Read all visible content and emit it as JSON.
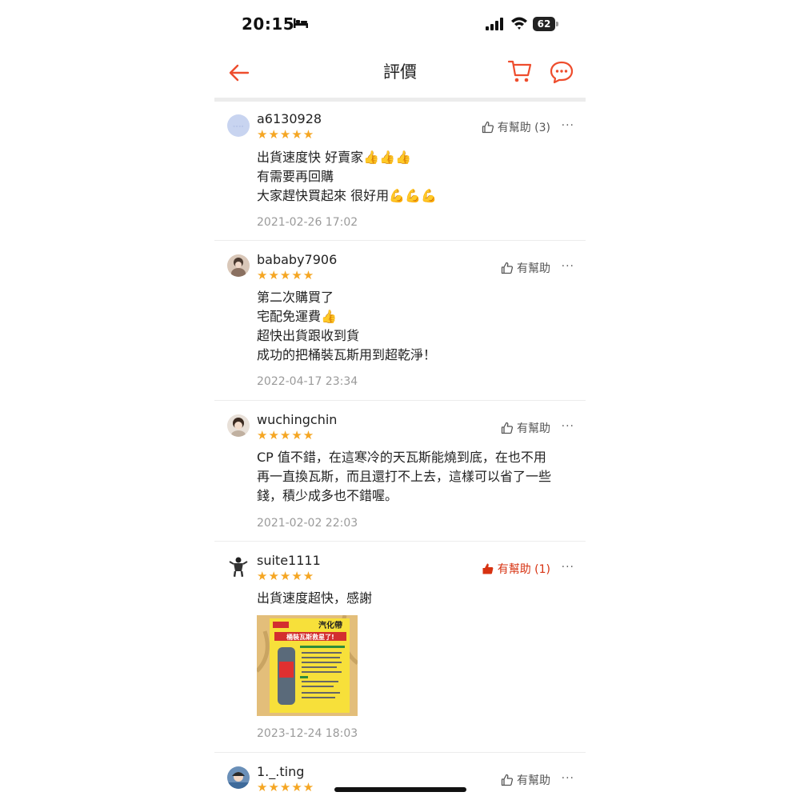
{
  "status_bar": {
    "time": "20:15",
    "battery": "62"
  },
  "header": {
    "title": "評價"
  },
  "icons": {
    "back": "arrow-left-icon",
    "cart": "shopping-cart-icon",
    "chat": "chat-bubble-icon",
    "thumb": "thumbs-up-icon",
    "more": "more-icon"
  },
  "colors": {
    "accent": "#ee4d2d",
    "stars": "#f5a623",
    "helpful_active": "#d73211"
  },
  "reviews": [
    {
      "username": "a6130928",
      "rating": 5,
      "stars": "★★★★★",
      "helpful": "有幫助 (3)",
      "helpful_active": false,
      "more": "···",
      "comment_lines": [
        "出貨速度快 好賣家",
        "有需要再回購",
        "大家趕快買起來 很好用"
      ],
      "emojis": [
        "👍👍👍",
        "",
        "💪💪💪"
      ],
      "date": "2021-02-26 17:02"
    },
    {
      "username": "bababy7906",
      "rating": 5,
      "stars": "★★★★★",
      "helpful": "有幫助",
      "helpful_active": false,
      "more": "···",
      "comment_lines": [
        "第二次購買了",
        "宅配免運費",
        "超快出貨跟收到貨",
        "成功的把桶裝瓦斯用到超乾淨！"
      ],
      "emojis": [
        "",
        "👍",
        "",
        ""
      ],
      "date": "2022-04-17 23:34"
    },
    {
      "username": "wuchingchin",
      "rating": 5,
      "stars": "★★★★★",
      "helpful": "有幫助",
      "helpful_active": false,
      "more": "···",
      "comment_lines": [
        "CP 值不錯，在這寒冷的天瓦斯能燒到底，在也不用",
        "再一直換瓦斯，而且還打不上去，這樣可以省了一些",
        "錢，積少成多也不錯喔。"
      ],
      "date": "2021-02-02 22:03"
    },
    {
      "username": "suite1111",
      "rating": 5,
      "stars": "★★★★★",
      "helpful": "有幫助 (1)",
      "helpful_active": true,
      "more": "···",
      "comment_lines": [
        "出貨速度超快，感謝"
      ],
      "photo": {
        "title": "汽化帶",
        "banner": "桶裝瓦斯救星了!"
      },
      "date": "2023-12-24 18:03"
    },
    {
      "username": "1._.ting",
      "rating": 5,
      "stars": "★★★★★",
      "helpful": "有幫助",
      "helpful_active": false,
      "more": "···"
    }
  ]
}
